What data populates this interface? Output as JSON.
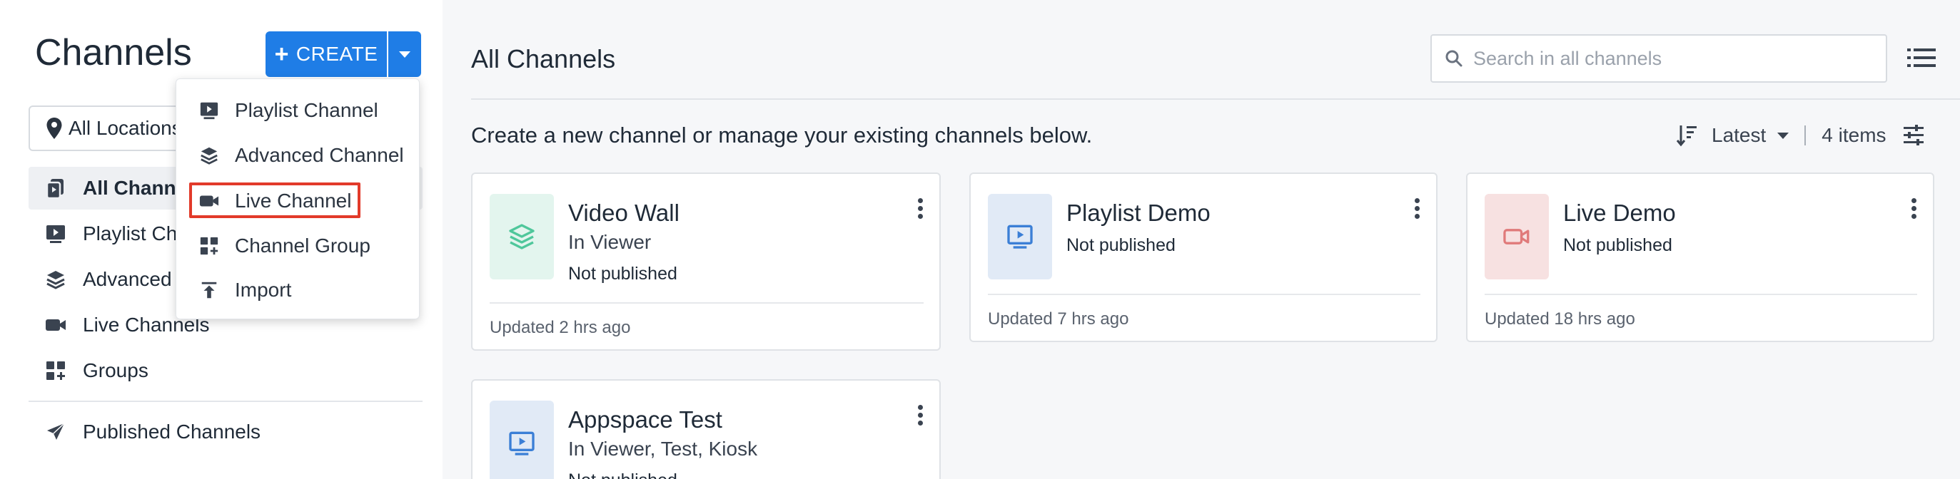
{
  "sidebar": {
    "title": "Channels",
    "create_label": "CREATE",
    "location_label": "All Locations",
    "nav": [
      {
        "label": "All Channels",
        "icon": "all-channels-icon"
      },
      {
        "label": "Playlist Channels",
        "icon": "playlist-icon"
      },
      {
        "label": "Advanced Channels",
        "icon": "layers-icon"
      },
      {
        "label": "Live Channels",
        "icon": "video-camera-icon"
      },
      {
        "label": "Groups",
        "icon": "grid-add-icon"
      },
      {
        "label": "Published Channels",
        "icon": "send-icon"
      }
    ]
  },
  "create_menu": {
    "items": [
      {
        "label": "Playlist Channel",
        "icon": "playlist-icon"
      },
      {
        "label": "Advanced Channel",
        "icon": "layers-icon"
      },
      {
        "label": "Live Channel",
        "icon": "video-camera-icon"
      },
      {
        "label": "Channel Group",
        "icon": "grid-add-icon"
      },
      {
        "label": "Import",
        "icon": "import-icon"
      }
    ],
    "highlighted_item": "Live Channel",
    "highlight_color": "#e23a2a"
  },
  "main": {
    "title": "All Channels",
    "search_placeholder": "Search in all channels",
    "subtitle": "Create a new channel or manage your existing channels below.",
    "sort_label": "Latest",
    "item_count": "4 items"
  },
  "cards": [
    {
      "name": "Video Wall",
      "subtitle": "In Viewer",
      "status": "Not published",
      "updated": "Updated 2 hrs ago",
      "type": "advanced",
      "thumb_color": "#e3f5ee",
      "icon_color": "#4fc79b"
    },
    {
      "name": "Playlist Demo",
      "subtitle": "",
      "status": "Not published",
      "updated": "Updated 7 hrs ago",
      "type": "playlist",
      "thumb_color": "#e1eaf6",
      "icon_color": "#3b7fd6"
    },
    {
      "name": "Live Demo",
      "subtitle": "",
      "status": "Not published",
      "updated": "Updated 18 hrs ago",
      "type": "live",
      "thumb_color": "#f7e1e1",
      "icon_color": "#e07a7a"
    },
    {
      "name": "Appspace Test",
      "subtitle": "In Viewer, Test, Kiosk",
      "status": "Not published",
      "updated": "",
      "type": "playlist",
      "thumb_color": "#e1eaf6",
      "icon_color": "#3b7fd6"
    }
  ],
  "colors": {
    "accent": "#1f7de6",
    "text": "#1f2a37",
    "background": "#f6f7f9"
  }
}
